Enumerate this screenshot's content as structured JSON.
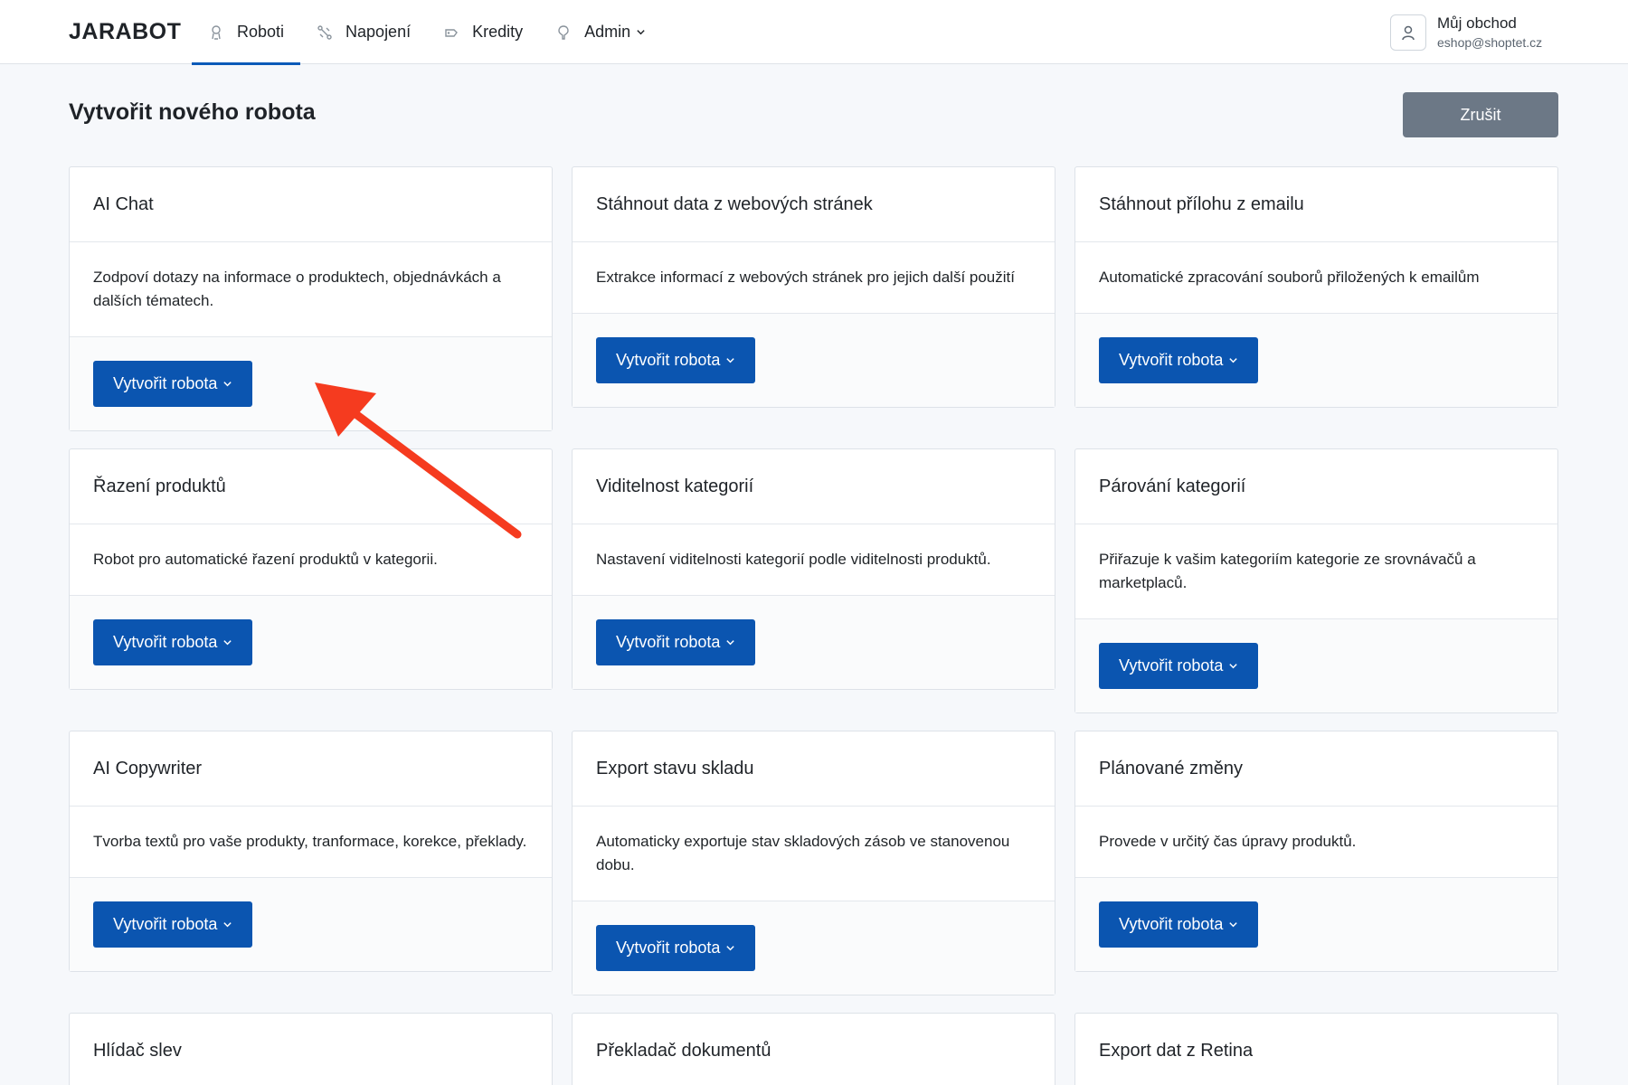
{
  "navbar": {
    "brand": "JARABOT",
    "items": [
      {
        "label": "Roboti",
        "icon": "robot-icon",
        "active": true
      },
      {
        "label": "Napojení",
        "icon": "connection-icon",
        "active": false
      },
      {
        "label": "Kredity",
        "icon": "coins-icon",
        "active": false
      },
      {
        "label": "Admin",
        "icon": "admin-icon",
        "active": false,
        "dropdown": true
      }
    ],
    "user": {
      "name": "Můj obchod",
      "email": "eshop@shoptet.cz"
    }
  },
  "page": {
    "title": "Vytvořit nového robota",
    "cancel_label": "Zrušit"
  },
  "cards": [
    {
      "title": "AI Chat",
      "description": "Zodpoví dotazy na informace o produktech, objednávkách a dalších tématech.",
      "button": "Vytvořit robota"
    },
    {
      "title": "Stáhnout data z webových stránek",
      "description": "Extrakce informací z webových stránek pro jejich další použití",
      "button": "Vytvořit robota"
    },
    {
      "title": "Stáhnout přílohu z emailu",
      "description": "Automatické zpracování souborů přiložených k emailům",
      "button": "Vytvořit robota"
    },
    {
      "title": "Řazení produktů",
      "description": "Robot pro automatické řazení produktů v kategorii.",
      "button": "Vytvořit robota"
    },
    {
      "title": "Viditelnost kategorií",
      "description": "Nastavení viditelnosti kategorií podle viditelnosti produktů.",
      "button": "Vytvořit robota"
    },
    {
      "title": "Párování kategorií",
      "description": "Přiřazuje k vašim kategoriím kategorie ze srovnávačů a marketplaců.",
      "button": "Vytvořit robota"
    },
    {
      "title": "AI Copywriter",
      "description": "Tvorba textů pro vaše produkty, tranformace, korekce, překlady.",
      "button": "Vytvořit robota"
    },
    {
      "title": "Export stavu skladu",
      "description": "Automaticky exportuje stav skladových zásob ve stanovenou dobu.",
      "button": "Vytvořit robota"
    },
    {
      "title": "Plánované změny",
      "description": "Provede v určitý čas úpravy produktů.",
      "button": "Vytvořit robota"
    },
    {
      "title": "Hlídač slev",
      "description": "",
      "button": ""
    },
    {
      "title": "Překladač dokumentů",
      "description": "",
      "button": ""
    },
    {
      "title": "Export dat z Retina",
      "description": "",
      "button": ""
    }
  ],
  "colors": {
    "primary": "#0b55b0",
    "secondary": "#6c7886",
    "annotation": "#f53b1f"
  }
}
